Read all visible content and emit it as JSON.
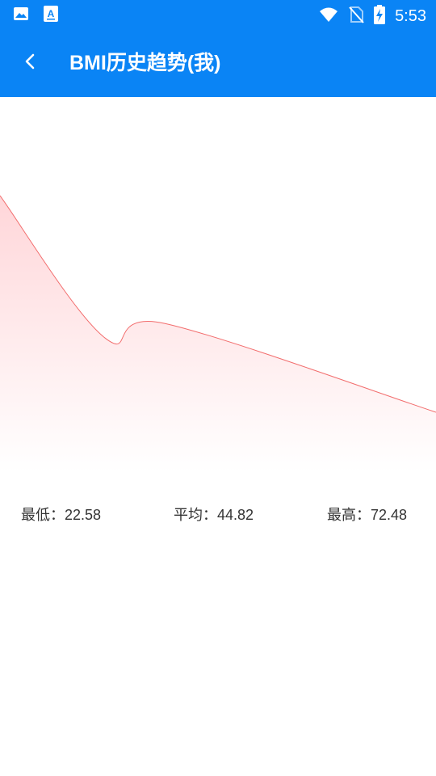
{
  "status_bar": {
    "time": "5:53",
    "icons": [
      "image-icon",
      "text-a-icon",
      "wifi-icon",
      "no-sim-icon",
      "battery-charging-icon"
    ]
  },
  "header": {
    "title": "BMI历史趋势(我)",
    "back_icon": "chevron-left-icon"
  },
  "colors": {
    "primary": "#0a84f5",
    "line": "#f26d6d",
    "fill_top": "#ffd6d9",
    "fill_bottom": "#ffffff",
    "text": "#333333"
  },
  "stats": {
    "min_label": "最低：",
    "min_value": "22.58",
    "avg_label": "平均：",
    "avg_value": "44.82",
    "max_label": "最高：",
    "max_value": "72.48"
  },
  "chart_data": {
    "type": "area",
    "title": "",
    "xlabel": "",
    "ylabel": "",
    "grid": false,
    "values": [
      72.48,
      39.7,
      43.0,
      22.58
    ]
  }
}
